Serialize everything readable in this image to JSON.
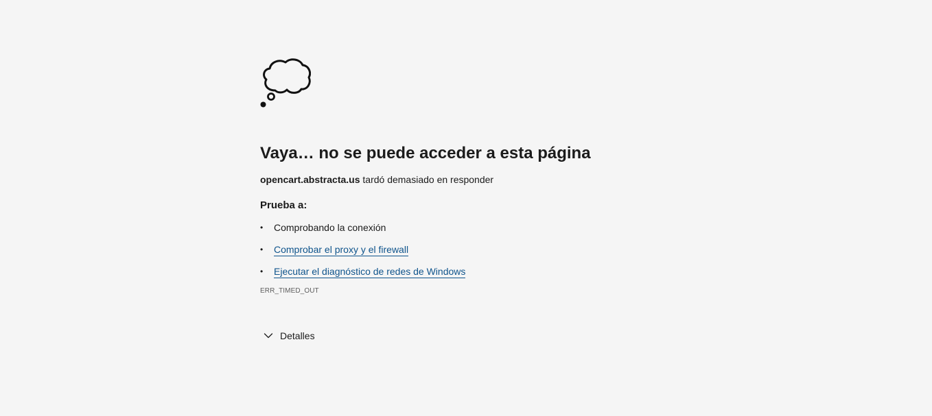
{
  "icon": "thought-cloud-icon",
  "title": "Vaya… no se puede acceder a esta página",
  "message": {
    "host": "opencart.abstracta.us",
    "text": " tardó demasiado en responder"
  },
  "try_heading": "Prueba a:",
  "suggestions": [
    {
      "label": "Comprobando la conexión",
      "is_link": false
    },
    {
      "label": "Comprobar el proxy y el firewall",
      "is_link": true
    },
    {
      "label": "Ejecutar el diagnóstico de redes de Windows",
      "is_link": true
    }
  ],
  "bullet": "•",
  "error_code": "ERR_TIMED_OUT",
  "details_label": "Detalles",
  "colors": {
    "background": "#f5f5f5",
    "text": "#1b1b1b",
    "link": "#0f548c",
    "muted": "#5c5c5c"
  }
}
